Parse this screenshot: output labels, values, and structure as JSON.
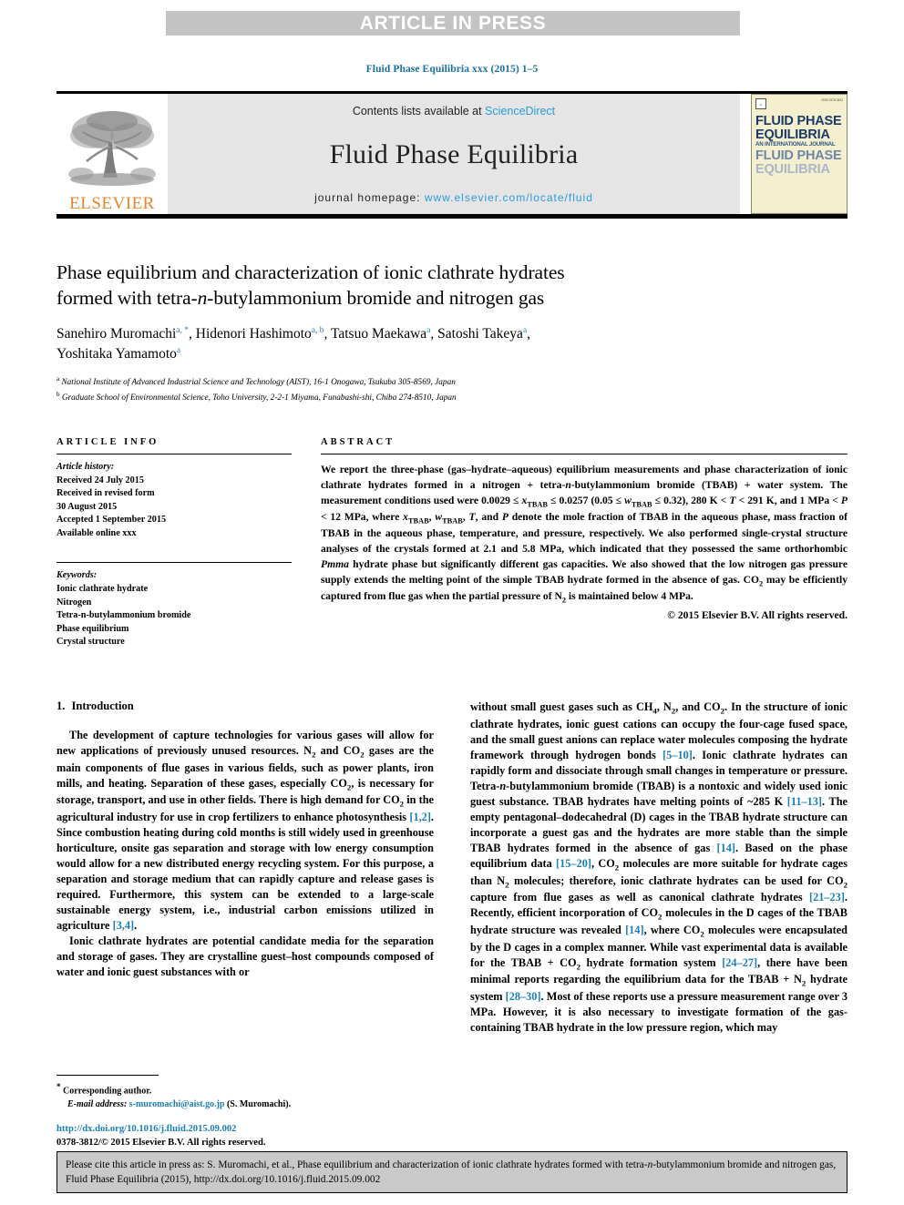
{
  "banner": {
    "text": "ARTICLE IN PRESS"
  },
  "journal_ref": "Fluid Phase Equilibria xxx (2015) 1–5",
  "masthead": {
    "contents_prefix": "Contents lists available at ",
    "sciencedirect": "ScienceDirect",
    "journal_name": "Fluid Phase Equilibria",
    "homepage_label": "journal homepage: ",
    "homepage_url": "www.elsevier.com/locate/fluid",
    "publisher": "ELSEVIER",
    "cover": {
      "brand": "ELSEVIER",
      "issn_note": "ISSN 0378-3812",
      "line1": "FLUID PHASE",
      "line2": "EQUILIBRIA",
      "subtitle": "AN INTERNATIONAL JOURNAL",
      "line3": "FLUID PHASE",
      "line4": "EQUILIBRIA"
    }
  },
  "title": {
    "line1": "Phase equilibrium and characterization of ionic clathrate hydrates",
    "line2_pre": "formed with tetra-",
    "line2_ital": "n",
    "line2_post": "-butylammonium bromide and nitrogen gas"
  },
  "authors": [
    {
      "name": "Sanehiro Muromachi",
      "marks": "a, *"
    },
    {
      "name": "Hidenori Hashimoto",
      "marks": "a, b"
    },
    {
      "name": "Tatsuo Maekawa",
      "marks": "a"
    },
    {
      "name": "Satoshi Takeya",
      "marks": "a"
    },
    {
      "name": "Yoshitaka Yamamoto",
      "marks": "a"
    }
  ],
  "affiliations": [
    {
      "mark": "a",
      "text": "National Institute of Advanced Industrial Science and Technology (AIST), 16-1 Onogawa, Tsukuba 305-8569, Japan"
    },
    {
      "mark": "b",
      "text": "Graduate School of Environmental Science, Toho University, 2-2-1 Miyama, Funabashi-shi, Chiba 274-8510, Japan"
    }
  ],
  "article_info": {
    "heading": "ARTICLE INFO",
    "history_title": "Article history:",
    "history": [
      "Received 24 July 2015",
      "Received in revised form",
      "30 August 2015",
      "Accepted 1 September 2015",
      "Available online xxx"
    ],
    "keywords_title": "Keywords:",
    "keywords": [
      "Ionic clathrate hydrate",
      "Nitrogen",
      "Tetra-n-butylammonium bromide",
      "Phase equilibrium",
      "Crystal structure"
    ]
  },
  "abstract": {
    "heading": "ABSTRACT",
    "paragraph_html": "We report the three-phase (gas–hydrate–aqueous) equilibrium measurements and phase characterization of ionic clathrate hydrates formed in a nitrogen + tetra-<i>n</i>-butylammonium bromide (TBAB) + water system. The measurement conditions used were 0.0029 ≤ <i>x</i><sub>TBAB</sub> ≤ 0.0257 (0.05 ≤ <i>w</i><sub>TBAB</sub> ≤ 0.32), 280 K &lt; <i>T</i> &lt; 291 K, and 1 MPa &lt; <i>P</i> &lt; 12 MPa, where <i>x</i><sub>TBAB</sub>, <i>w</i><sub>TBAB</sub>, <i>T</i>, and <i>P</i> denote the mole fraction of TBAB in the aqueous phase, mass fraction of TBAB in the aqueous phase, temperature, and pressure, respectively. We also performed single-crystal structure analyses of the crystals formed at 2.1 and 5.8 MPa, which indicated that they possessed the same orthorhombic <i>Pmma</i> hydrate phase but significantly different gas capacities. We also showed that the low nitrogen gas pressure supply extends the melting point of the simple TBAB hydrate formed in the absence of gas. CO<sub>2</sub> may be efficiently captured from flue gas when the partial pressure of N<sub>2</sub> is maintained below 4 MPa.",
    "copyright": "© 2015 Elsevier B.V. All rights reserved."
  },
  "introduction": {
    "number": "1.",
    "title": "Introduction",
    "left_paragraphs_html": [
      "The development of capture technologies for various gases will allow for new applications of previously unused resources. N<sub>2</sub> and CO<sub>2</sub> gases are the main components of flue gases in various fields, such as power plants, iron mills, and heating. Separation of these gases, especially CO<sub>2</sub>, is necessary for storage, transport, and use in other fields. There is high demand for CO<sub>2</sub> in the agricultural industry for use in crop fertilizers to enhance photosynthesis <span class=\"ref\">[1,2]</span>. Since combustion heating during cold months is still widely used in greenhouse horticulture, onsite gas separation and storage with low energy consumption would allow for a new distributed energy recycling system. For this purpose, a separation and storage medium that can rapidly capture and release gases is required. Furthermore, this system can be extended to a large-scale sustainable energy system, i.e., industrial carbon emissions utilized in agriculture <span class=\"ref\">[3,4]</span>.",
      "Ionic clathrate hydrates are potential candidate media for the separation and storage of gases. They are crystalline guest–host compounds composed of water and ionic guest substances with or"
    ],
    "right_paragraphs_html": [
      "without small guest gases such as CH<sub>4</sub>, N<sub>2</sub>, and CO<sub>2</sub>. In the structure of ionic clathrate hydrates, ionic guest cations can occupy the four-cage fused space, and the small guest anions can replace water molecules composing the hydrate framework through hydrogen bonds <span class=\"ref\">[5–10]</span>. Ionic clathrate hydrates can rapidly form and dissociate through small changes in temperature or pressure. Tetra-<i>n</i>-butylammonium bromide (TBAB) is a nontoxic and widely used ionic guest substance. TBAB hydrates have melting points of ~285 K <span class=\"ref\">[11–13]</span>. The empty pentagonal–dodecahedral (D) cages in the TBAB hydrate structure can incorporate a guest gas and the hydrates are more stable than the simple TBAB hydrates formed in the absence of gas <span class=\"ref\">[14]</span>. Based on the phase equilibrium data <span class=\"ref\">[15–20]</span>, CO<sub>2</sub> molecules are more suitable for hydrate cages than N<sub>2</sub> molecules; therefore, ionic clathrate hydrates can be used for CO<sub>2</sub> capture from flue gases as well as canonical clathrate hydrates <span class=\"ref\">[21–23]</span>. Recently, efficient incorporation of CO<sub>2</sub> molecules in the D cages of the TBAB hydrate structure was revealed <span class=\"ref\">[14]</span>, where CO<sub>2</sub> molecules were encapsulated by the D cages in a complex manner. While vast experimental data is available for the TBAB + CO<sub>2</sub> hydrate formation system <span class=\"ref\">[24–27]</span>, there have been minimal reports regarding the equilibrium data for the TBAB + N<sub>2</sub> hydrate system <span class=\"ref\">[28–30]</span>. Most of these reports use a pressure measurement range over 3 MPa. However, it is also necessary to investigate formation of the gas-containing TBAB hydrate in the low pressure region, which may"
    ]
  },
  "footnote": {
    "star": "*",
    "corresponding": "Corresponding author.",
    "email_label": "E-mail address:",
    "email": "s-muromachi@aist.go.jp",
    "email_owner": "(S. Muromachi)."
  },
  "doi_block": {
    "doi": "http://dx.doi.org/10.1016/j.fluid.2015.09.002",
    "issn_line": "0378-3812/© 2015 Elsevier B.V. All rights reserved."
  },
  "cite_box": {
    "html": "Please cite this article in press as: S. Muromachi, et al., Phase equilibrium and characterization of ionic clathrate hydrates formed with tetra-<i>n</i>-butylammonium bromide and nitrogen gas, Fluid Phase Equilibria (2015), http://dx.doi.org/10.1016/j.fluid.2015.09.002"
  },
  "colors": {
    "banner_bg": "#c3c3c3",
    "link_blue": "#1a7fb5",
    "sciencedirect_blue": "#2b9ad6",
    "elsevier_orange": "#e8842a",
    "masthead_bg": "#e5e5e5",
    "cite_box_bg": "#c9c9c9",
    "cover_bg": "#f4f0cf"
  }
}
